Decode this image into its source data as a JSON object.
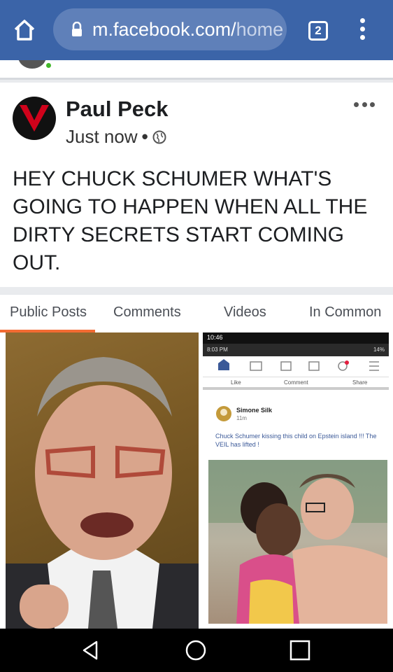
{
  "browser": {
    "url_domain": "m.facebook.com/",
    "url_path": "home",
    "tab_count": "2"
  },
  "post": {
    "author": "Paul Peck",
    "time": "Just now",
    "separator": "•",
    "text": "HEY CHUCK SCHUMER WHAT'S GOING TO HAPPEN WHEN ALL THE DIRTY SECRETS START COMING OUT."
  },
  "tabs": [
    "Public Posts",
    "Comments",
    "Videos",
    "In Common"
  ],
  "inner_screenshot": {
    "status_time": "10:46",
    "status_time2": "8:03 PM",
    "battery": "14%",
    "actions": [
      "Like",
      "Comment",
      "Share"
    ],
    "author": "Simone Silk",
    "time": "11m",
    "caption": "Chuck Schumer kissing this child on Epstein island !!! The VEIL has lifted !"
  },
  "colors": {
    "browser_bar": "#3b64a8",
    "tab_active": "#f36b32",
    "avatar_red": "#d0021b"
  }
}
